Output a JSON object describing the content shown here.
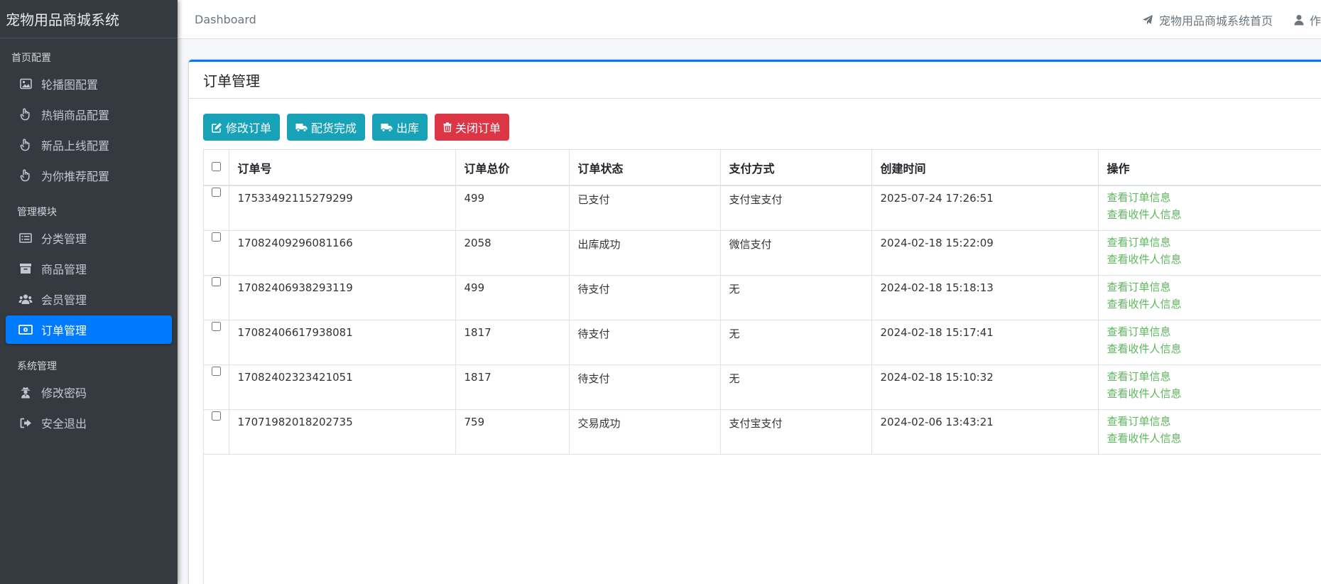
{
  "sidebar": {
    "brand": "宠物用品商城系统",
    "sections": [
      {
        "header": "首页配置",
        "items": [
          {
            "label": "轮播图配置",
            "icon": "image-icon"
          },
          {
            "label": "热销商品配置",
            "icon": "hand-pointer-icon"
          },
          {
            "label": "新品上线配置",
            "icon": "hand-pointer-icon"
          },
          {
            "label": "为你推荐配置",
            "icon": "hand-pointer-icon"
          }
        ]
      },
      {
        "header": "管理模块",
        "items": [
          {
            "label": "分类管理",
            "icon": "list-icon"
          },
          {
            "label": "商品管理",
            "icon": "archive-icon"
          },
          {
            "label": "会员管理",
            "icon": "users-icon"
          },
          {
            "label": "订单管理",
            "icon": "money-bill-icon",
            "active": true
          }
        ]
      },
      {
        "header": "系统管理",
        "items": [
          {
            "label": "修改密码",
            "icon": "user-secret-icon"
          },
          {
            "label": "安全退出",
            "icon": "sign-out-icon"
          }
        ]
      }
    ]
  },
  "topbar": {
    "breadcrumb": "Dashboard",
    "home_link": "宠物用品商城系统首页",
    "user_label": "作者"
  },
  "card": {
    "title": "订单管理",
    "buttons": {
      "edit": "修改订单",
      "done": "配货完成",
      "ship": "出库",
      "close": "关闭订单"
    }
  },
  "table": {
    "headers": [
      "订单号",
      "订单总价",
      "订单状态",
      "支付方式",
      "创建时间",
      "操作"
    ],
    "action_order": "查看订单信息",
    "action_receiver": "查看收件人信息",
    "rows": [
      [
        "17533492115279299",
        "499",
        "已支付",
        "支付宝支付",
        "2025-07-24 17:26:51"
      ],
      [
        "17082409296081166",
        "2058",
        "出库成功",
        "微信支付",
        "2024-02-18 15:22:09"
      ],
      [
        "17082406938293119",
        "499",
        "待支付",
        "无",
        "2024-02-18 15:18:13"
      ],
      [
        "17082406617938081",
        "1817",
        "待支付",
        "无",
        "2024-02-18 15:17:41"
      ],
      [
        "17082402323421051",
        "1817",
        "待支付",
        "无",
        "2024-02-18 15:10:32"
      ],
      [
        "17071982018202735",
        "759",
        "交易成功",
        "支付宝支付",
        "2024-02-06 13:43:21"
      ]
    ]
  },
  "colors": {
    "sidebar_bg": "#343a40",
    "active": "#007bff",
    "info": "#17a2b8",
    "danger": "#dc3545",
    "link_green": "#5cb85c"
  }
}
